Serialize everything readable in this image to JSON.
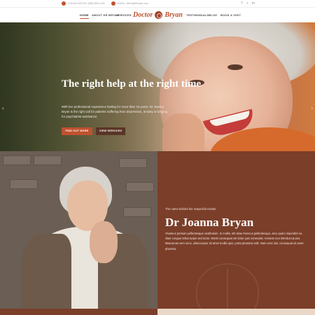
{
  "topbar": {
    "phone_text": "CONSULTATION: (555) 555-1234",
    "email_text": "EMAIL: office@drbryan.com",
    "social": [
      "f",
      "•",
      "in"
    ]
  },
  "nav": {
    "left_items": [
      "HOME",
      "ABOUT DR BRYAN",
      "SERVICES"
    ],
    "logo_left": "Doctor",
    "logo_right": "Bryan",
    "right_items": [
      "TESTIMONIALS",
      "BLOG",
      "BOOK A VISIT"
    ]
  },
  "hero": {
    "headline": "The right help at the right time",
    "description": "With her professional experience lasting for more than 15 years, Dr Joanna Bryan is the right call for patients suffering from depression, anxiety or longing for psychiatrist assistance.",
    "primary_button": "FIND OUT MORE",
    "secondary_button": "VIEW SERVICES",
    "arrow_left": "‹",
    "arrow_right": "›"
  },
  "about": {
    "kicker": "The name behind the respectful results",
    "name": "Dr Joanna Bryan",
    "body": "Vivamus pretium pellentesque vestibulum. In mollis, elit vitae rhoncus pellentesque, arcu quam imperdiet ex, vitae congue tellus turpis sed tortor. Morbi consequat vel dolor quis venenatis. Aenean non interdum purus. Maecenas sem nunc, ullamcorper sit amet mollis quis, porta pharetra velit. Nam eros nisi, consequat sit amet pharetra."
  },
  "colors": {
    "accent": "#c0512f",
    "dark_brown": "#5b3526",
    "panel_brown": "#7a3e29"
  }
}
